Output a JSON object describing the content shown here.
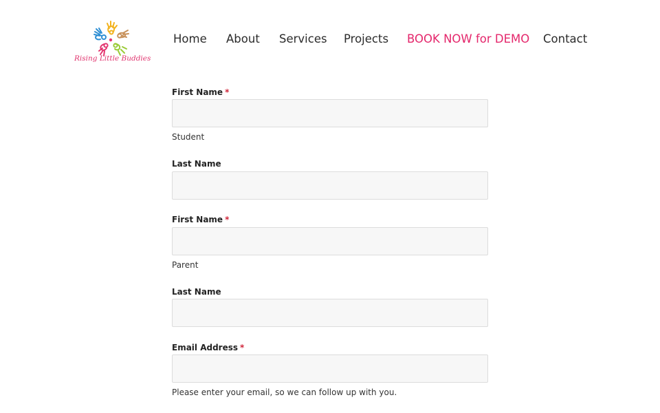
{
  "brand": {
    "logo_text": "Rising Little Buddies",
    "colors": [
      "#2f8fd4",
      "#f2b21c",
      "#e3356f",
      "#9acb36",
      "#c8925c",
      "#f26a21"
    ]
  },
  "nav": {
    "items": [
      {
        "label": "Home"
      },
      {
        "label": "About"
      },
      {
        "label": "Services"
      },
      {
        "label": "Projects"
      },
      {
        "label": "BOOK NOW for DEMO",
        "active": true
      },
      {
        "label": "Contact"
      }
    ],
    "active_color": "#e4266b"
  },
  "form": {
    "fields": [
      {
        "label": "First Name",
        "required": true,
        "value": "",
        "hint": "Student"
      },
      {
        "label": "Last Name",
        "required": false,
        "value": ""
      },
      {
        "label": "First Name",
        "required": true,
        "value": "",
        "hint": "Parent"
      },
      {
        "label": "Last Name",
        "required": false,
        "value": ""
      },
      {
        "label": "Email Address",
        "required": true,
        "value": "",
        "hint": "Please enter your email, so we can follow up with you."
      }
    ],
    "required_marker": "*"
  }
}
